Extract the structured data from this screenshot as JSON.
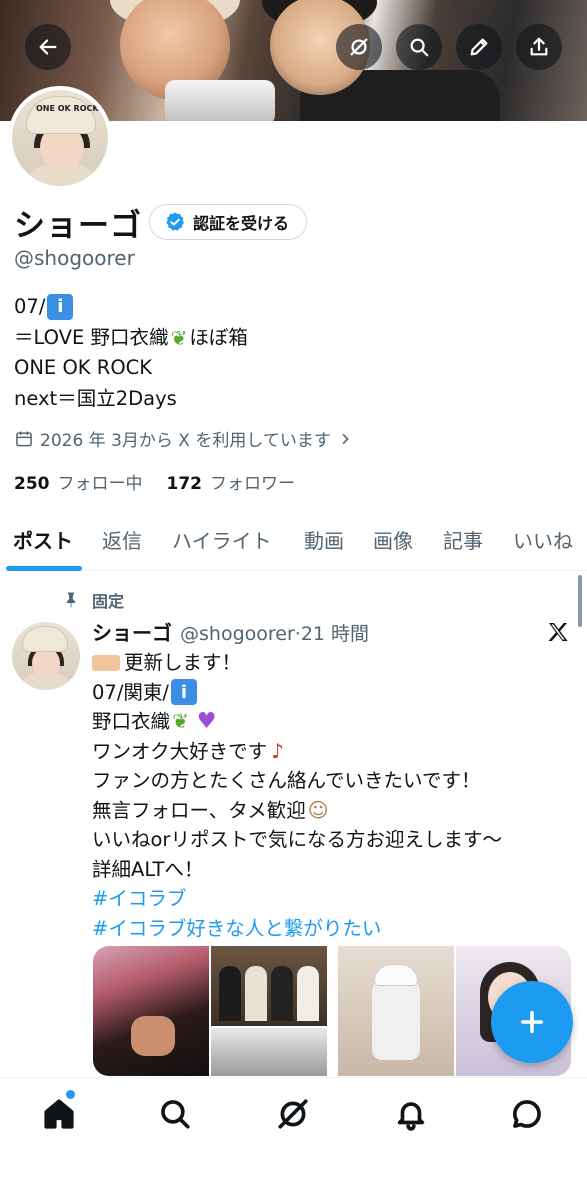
{
  "header": {
    "back_icon": "arrow-left-icon",
    "actions": [
      "grok-icon",
      "search-icon",
      "edit-icon",
      "share-icon"
    ]
  },
  "profile": {
    "avatar_hat_text": "ONE OK ROCK",
    "name": "ショーゴ",
    "verify_button_label": "認証を受ける",
    "handle": "@shogoorer",
    "bio_lines": {
      "line1_prefix": "07/",
      "line1_emoji": "🚹",
      "line2_prefix": "＝LOVE 野口衣織",
      "line2_emoji": "🌱",
      "line2_suffix": "ほぼ箱",
      "line3": "ONE OK ROCK",
      "line4": "next＝国立2Days"
    },
    "joined": "2026 年 3月から X を利用しています",
    "following_count": "250",
    "following_label": "フォロー中",
    "followers_count": "172",
    "followers_label": "フォロワー"
  },
  "tabs": {
    "posts": "ポスト",
    "replies": "返信",
    "highlights": "ハイライト",
    "videos": "動画",
    "images": "画像",
    "articles": "記事",
    "likes": "いいね"
  },
  "post": {
    "pinned_label": "固定",
    "author_name": "ショーゴ",
    "author_handle": "@shogoorer",
    "separator": "·",
    "time": "21 時間",
    "lines": {
      "l1": "更新します！",
      "l2_prefix": "07/関東/",
      "l2_emoji": "🚹",
      "l3_prefix": "野口衣織",
      "l3_emoji1": "🌱",
      "l3_emoji2": "💜",
      "l4": "ワンオク大好きです",
      "l4_emoji": "🎸",
      "l5": "ファンの方とたくさん絡んでいきたいです！",
      "l6": "無言フォロー、タメ歓迎",
      "l6_emoji": "🙆",
      "l7": "いいねorリポストで気になる方お迎えします〜",
      "l8": "詳細ALTへ！",
      "hashtag1": "#イコラブ",
      "hashtag2": "#イコラブ好きな人と繋がりたい"
    }
  },
  "colors": {
    "accent": "#1d9bf0",
    "text": "#0f1419",
    "secondary": "#536471",
    "border": "#eff3f4"
  },
  "bottom_nav": [
    "home-icon",
    "search-icon",
    "grok-icon",
    "notifications-icon",
    "messages-icon"
  ]
}
